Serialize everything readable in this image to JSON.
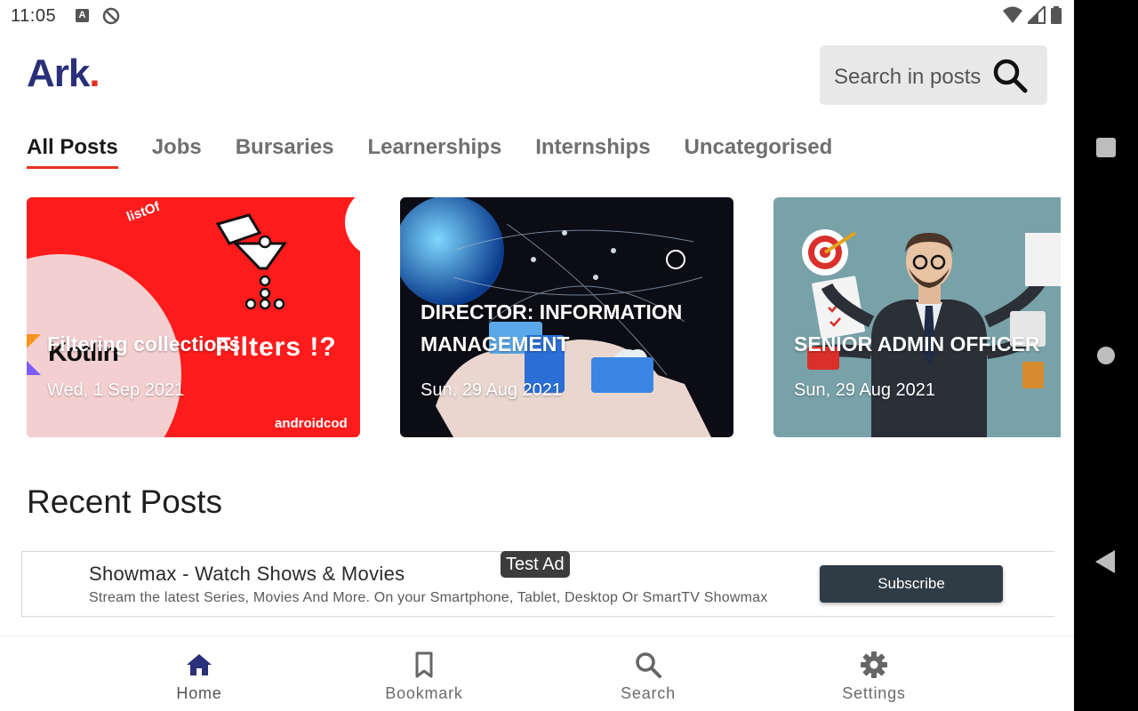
{
  "status_bar": {
    "time": "11:05",
    "keyboard_badge": "A"
  },
  "header": {
    "brand": "Ark",
    "brand_dot": ".",
    "search_placeholder": "Search in posts"
  },
  "tabs": [
    {
      "label": "All Posts",
      "active": true
    },
    {
      "label": "Jobs",
      "active": false
    },
    {
      "label": "Bursaries",
      "active": false
    },
    {
      "label": "Learnerships",
      "active": false
    },
    {
      "label": "Internships",
      "active": false
    },
    {
      "label": "Uncategorised",
      "active": false
    }
  ],
  "featured_posts": [
    {
      "title": "Filtering collections",
      "date": "Wed, 1 Sep 2021",
      "image_text": {
        "list_of": "listOf",
        "kotlin": "Kotlin",
        "filters": "Filters !?",
        "site": "androidcod"
      }
    },
    {
      "title": "DIRECTOR: INFORMATION MANAGEMENT",
      "date": "Sun, 29 Aug 2021"
    },
    {
      "title": "SENIOR ADMIN OFFICER",
      "date": "Sun, 29 Aug 2021"
    }
  ],
  "recent_posts": {
    "title": "Recent Posts"
  },
  "ad": {
    "badge": "Test Ad",
    "title": "Showmax - Watch Shows & Movies",
    "description": "Stream the latest Series, Movies And More. On your Smartphone, Tablet, Desktop Or SmartTV Showmax",
    "button": "Subscribe"
  },
  "bottom_nav": [
    {
      "label": "Home",
      "icon": "home-icon",
      "active": true
    },
    {
      "label": "Bookmark",
      "icon": "bookmark-icon",
      "active": false
    },
    {
      "label": "Search",
      "icon": "search-icon",
      "active": false
    },
    {
      "label": "Settings",
      "icon": "gear-icon",
      "active": false
    }
  ],
  "colors": {
    "brand": "#2a2f7a",
    "accent": "#e3311e",
    "active_nav": "#2a2f7a",
    "inactive_nav": "#6b6b6b"
  }
}
